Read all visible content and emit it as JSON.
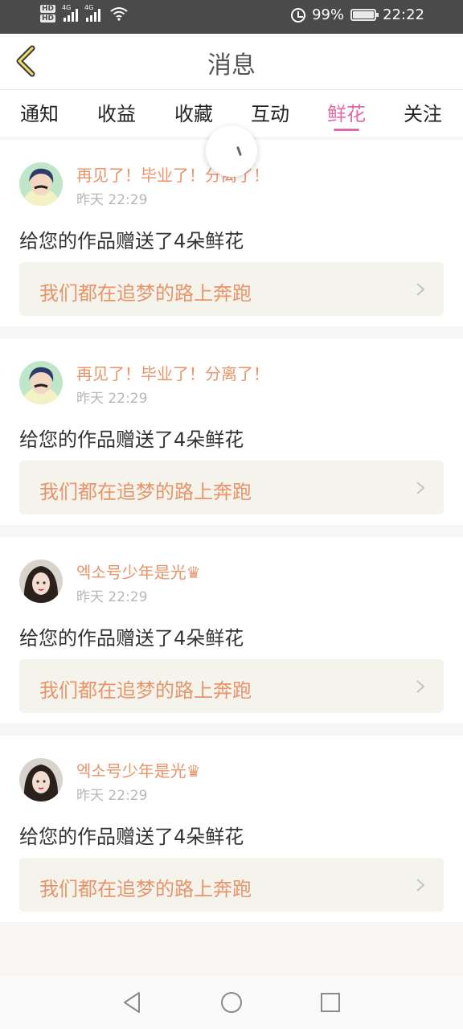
{
  "status_bar": {
    "network_badge_1": "HD",
    "network_badge_2": "HD",
    "signal_1_label": "4G",
    "signal_2_label": "4G",
    "battery_percent": "99%",
    "time": "22:22"
  },
  "header": {
    "title": "消息"
  },
  "tabs": [
    {
      "label": "通知"
    },
    {
      "label": "收益"
    },
    {
      "label": "收藏"
    },
    {
      "label": "互动"
    },
    {
      "label": "鲜花",
      "active": true
    },
    {
      "label": "关注"
    }
  ],
  "notifications": [
    {
      "user": "再见了！毕业了！分离了！",
      "time": "昨天 22:29",
      "message": "给您的作品赠送了4朵鲜花",
      "work": "我们都在追梦的路上奔跑"
    },
    {
      "user": "再见了！毕业了！分离了！",
      "time": "昨天 22:29",
      "message": "给您的作品赠送了4朵鲜花",
      "work": "我们都在追梦的路上奔跑"
    },
    {
      "user": "엑소号少年是光♛",
      "time": "昨天 22:29",
      "message": "给您的作品赠送了4朵鲜花",
      "work": "我们都在追梦的路上奔跑"
    },
    {
      "user": "엑소号少年是光♛",
      "time": "昨天 22:29",
      "message": "给您的作品赠送了4朵鲜花",
      "work": "我们都在追梦的路上奔跑"
    }
  ],
  "colors": {
    "accent_pink": "#e06aa8",
    "accent_orange": "#e8946a",
    "back_arrow_yellow": "#f0e06a"
  },
  "icons": {
    "back": "chevron-left-icon",
    "card_arrow": "chevron-right-icon",
    "nav_back": "triangle-back-icon",
    "nav_home": "circle-home-icon",
    "nav_recent": "square-recent-icon"
  }
}
